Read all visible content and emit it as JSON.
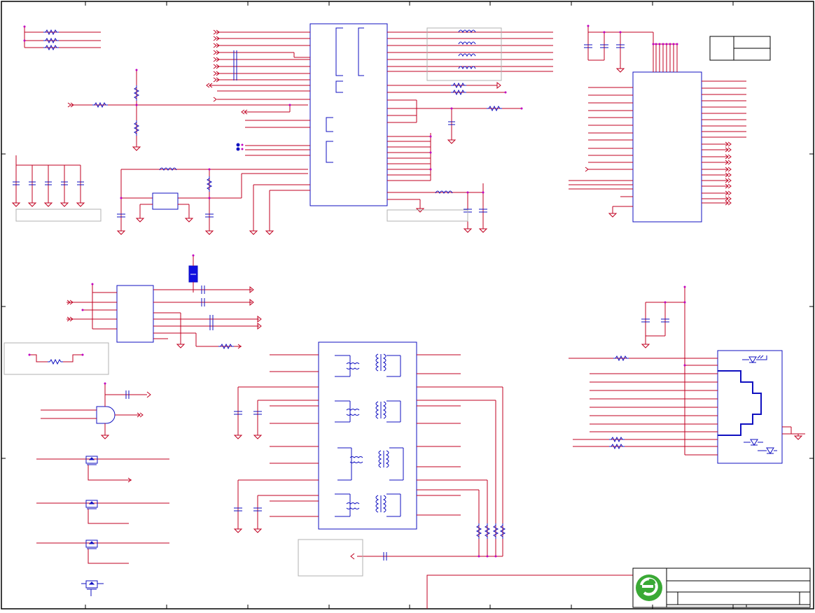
{
  "sheet": {
    "colors": {
      "background": "#ffffff",
      "frame": "#000000",
      "wire": "#c00020",
      "component": "#1010c0",
      "junction": "#c000c0",
      "grey_box": "#b0b0b0",
      "highlight": "#1010e0",
      "logo_green": "#3aa935"
    },
    "title_block": {
      "logo_icon": "company-logo-icon"
    }
  }
}
